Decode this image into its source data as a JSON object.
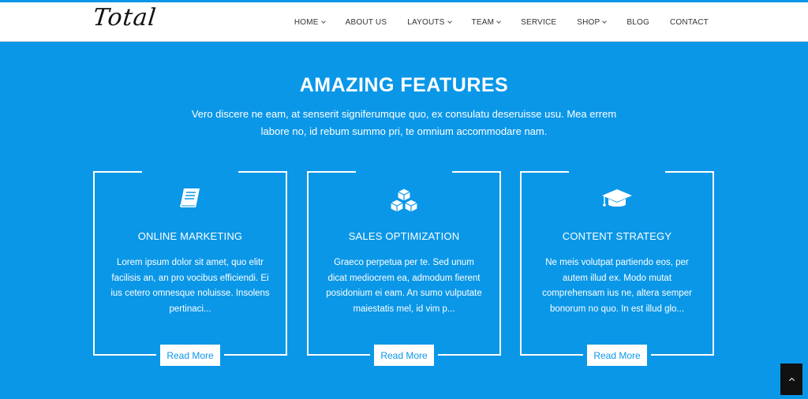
{
  "site": {
    "logo": "Total"
  },
  "nav": {
    "items": [
      {
        "label": "HOME",
        "has_dropdown": true
      },
      {
        "label": "ABOUT US",
        "has_dropdown": false
      },
      {
        "label": "LAYOUTS",
        "has_dropdown": true
      },
      {
        "label": "TEAM",
        "has_dropdown": true
      },
      {
        "label": "SERVICE",
        "has_dropdown": false
      },
      {
        "label": "SHOP",
        "has_dropdown": true
      },
      {
        "label": "BLOG",
        "has_dropdown": false
      },
      {
        "label": "CONTACT",
        "has_dropdown": false
      }
    ]
  },
  "features": {
    "title": "AMAZING FEATURES",
    "description": "Vero discere ne eam, at senserit signiferumque quo, ex consulatu deseruisse usu. Mea errem labore no, id rebum summo pri, te omnium accommodare nam.",
    "cards": [
      {
        "icon": "book-icon",
        "title": "ONLINE MARKETING",
        "text": "Lorem ipsum dolor sit amet, quo elitr facilisis an, an pro vocibus efficiendi. Ei ius cetero omnesque noluisse. Insolens pertinaci...",
        "button": "Read More"
      },
      {
        "icon": "cubes-icon",
        "title": "SALES OPTIMIZATION",
        "text": "Graeco perpetua per te. Sed unum dicat mediocrem ea, admodum fierent posidonium ei eam. An sumo vulputate maiestatis mel, id vim p...",
        "button": "Read More"
      },
      {
        "icon": "graduation-cap-icon",
        "title": "CONTENT STRATEGY",
        "text": "Ne meis volutpat partiendo eos, per autem illud ex. Modo mutat comprehensam ius ne, altera semper bonorum no quo. In est illud glo...",
        "button": "Read More"
      }
    ]
  },
  "colors": {
    "accent": "#0a97e8",
    "header_bg": "#ffffff",
    "scroll_top_bg": "#111111"
  },
  "scroll_top": {
    "icon": "chevron-up-icon"
  }
}
